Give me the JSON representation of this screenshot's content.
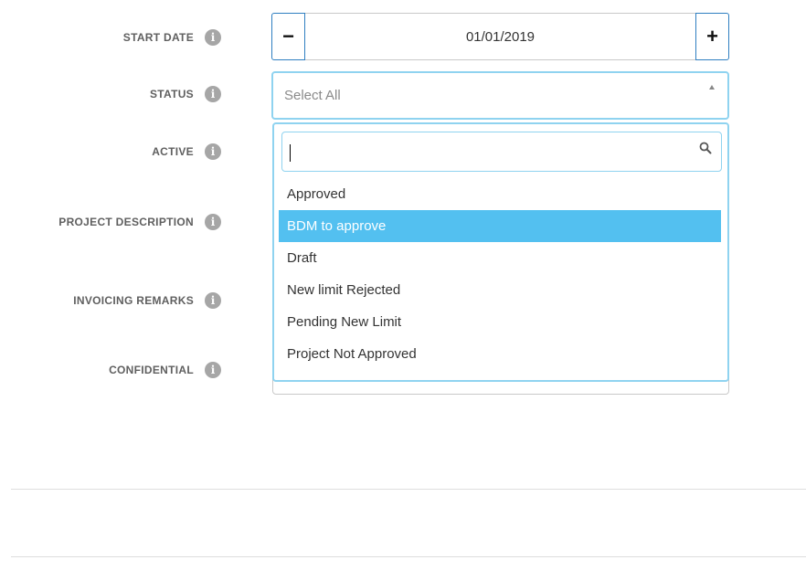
{
  "labels": {
    "start_date": "START DATE",
    "status": "STATUS",
    "active": "ACTIVE",
    "project_description": "PROJECT DESCRIPTION",
    "invoicing_remarks": "INVOICING REMARKS",
    "confidential": "CONFIDENTIAL"
  },
  "info_icon_glyph": "i",
  "start_date": {
    "minus_label": "−",
    "plus_label": "+",
    "value": "01/01/2019"
  },
  "status": {
    "placeholder": "Select All",
    "search_value": "",
    "options": [
      "Approved",
      "BDM to approve",
      "Draft",
      "New limit Rejected",
      "Pending New Limit",
      "Project Not Approved"
    ],
    "highlighted_option": "BDM to approve"
  },
  "colors": {
    "focus_border": "#8fd3f0",
    "highlight": "#53c0f0",
    "stepper_border": "#2f7fc1",
    "info_icon": "#a6a6a6"
  }
}
